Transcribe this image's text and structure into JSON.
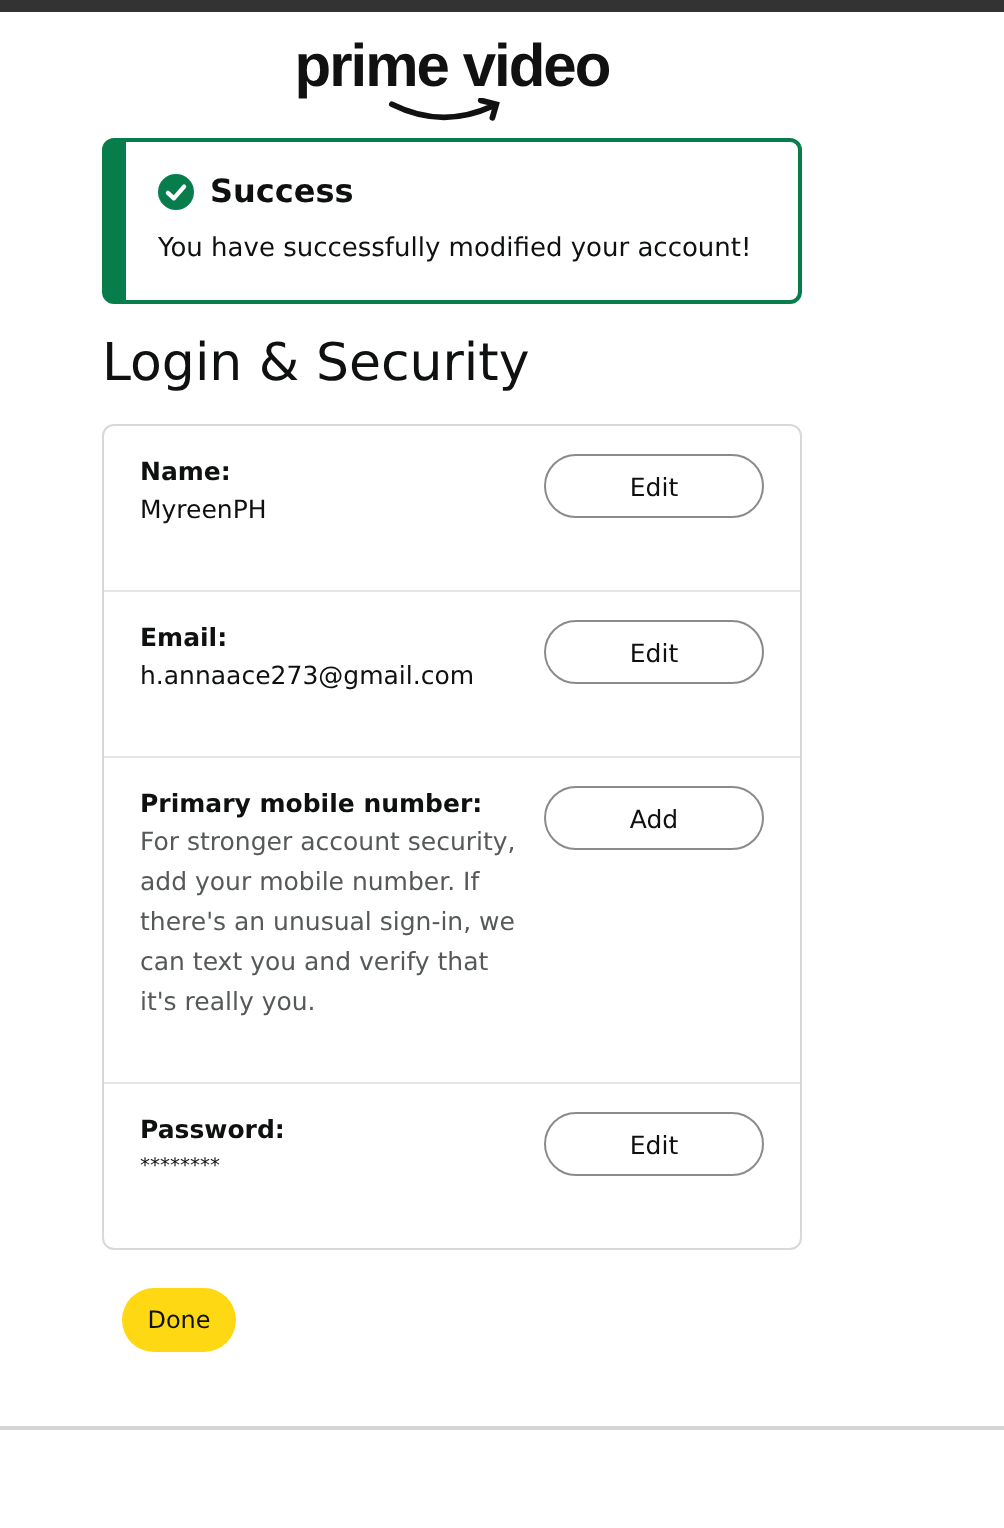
{
  "logo": {
    "text": "prime video"
  },
  "alert": {
    "title": "Success",
    "message": "You have successfully modified your account!"
  },
  "heading": "Login & Security",
  "rows": [
    {
      "label": "Name:",
      "kind": "text",
      "value": "MyreenPH",
      "button": "Edit"
    },
    {
      "label": "Email:",
      "kind": "text",
      "value": "h.annaace273@gmail.com",
      "button": "Edit"
    },
    {
      "label": "Primary mobile number:",
      "kind": "hint",
      "value": "For stronger account security, add your mobile number. If there's an unusual sign-in, we can text you and verify that it's really you.",
      "button": "Add"
    },
    {
      "label": "Password:",
      "kind": "secret",
      "value": "********",
      "button": "Edit"
    }
  ],
  "done_button": "Done"
}
